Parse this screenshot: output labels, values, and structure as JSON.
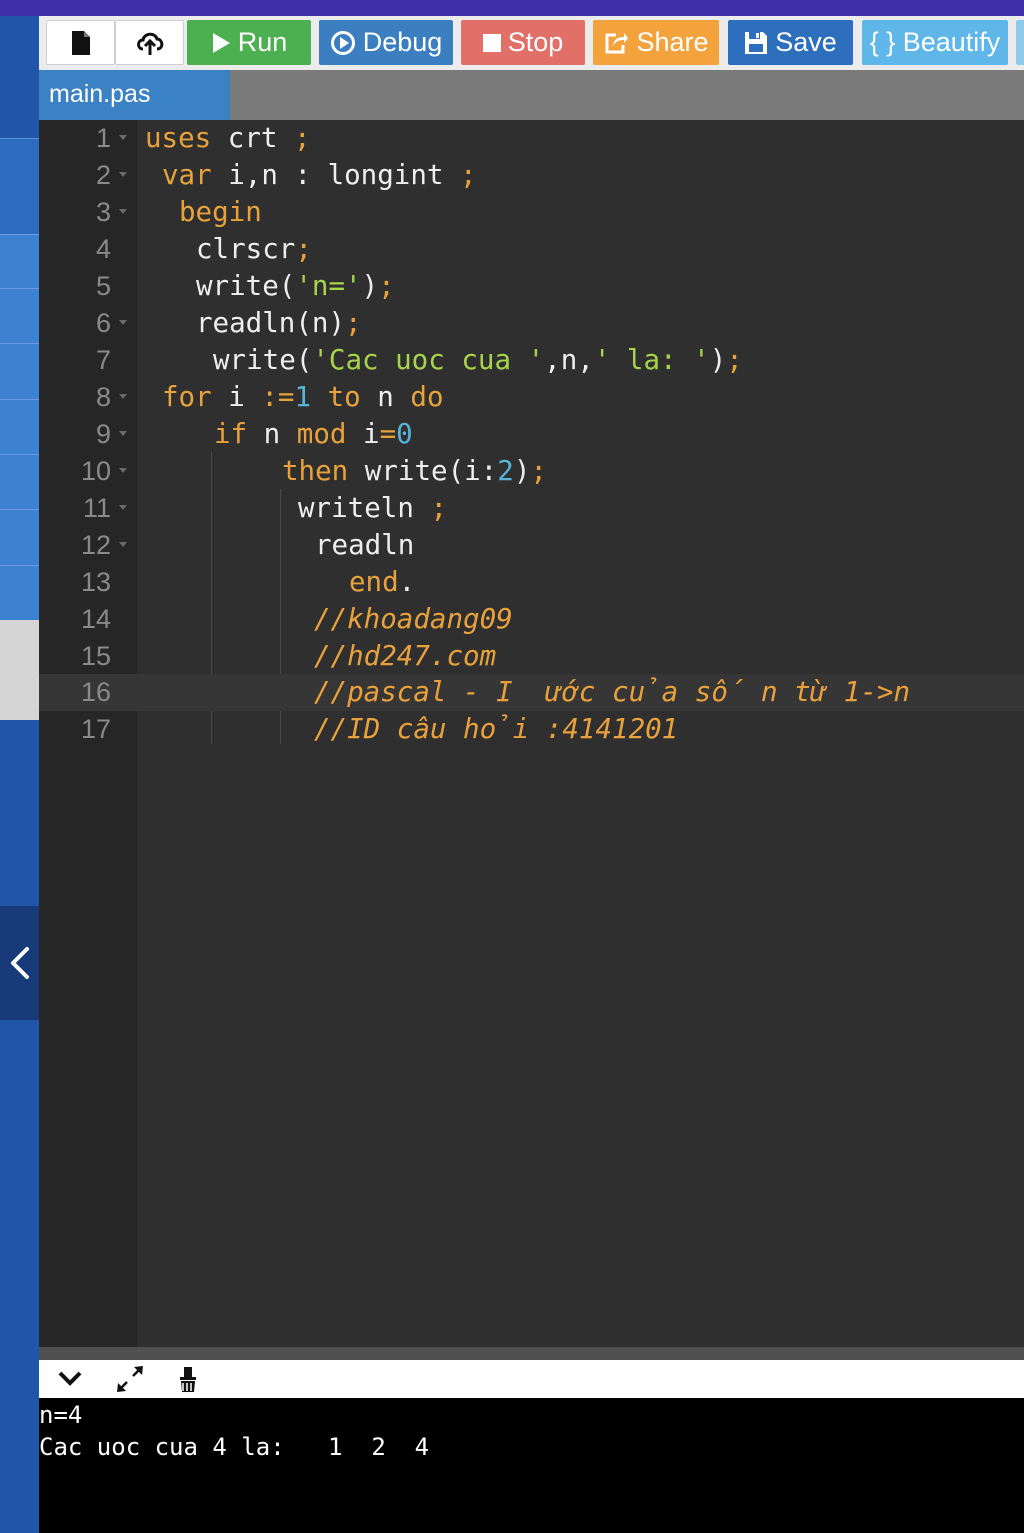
{
  "toolbar": {
    "buttons": [
      {
        "label": "",
        "icon": "new-file-icon",
        "bg": "#ffffff"
      },
      {
        "label": "",
        "icon": "upload-icon",
        "bg": "#ffffff"
      },
      {
        "label": "Run",
        "icon": "play-icon",
        "bg": "#4caf50"
      },
      {
        "label": "Debug",
        "icon": "debug-icon",
        "bg": "#3c7fc0"
      },
      {
        "label": "Stop",
        "icon": "stop-icon",
        "bg": "#e07068"
      },
      {
        "label": "Share",
        "icon": "share-icon",
        "bg": "#f4a23c"
      },
      {
        "label": "Save",
        "icon": "save-icon",
        "bg": "#2d6fbc"
      },
      {
        "label": "{ } Beautify",
        "icon": "",
        "bg": "#5fb6e8"
      }
    ]
  },
  "tab": {
    "label": "main.pas"
  },
  "editor": {
    "active_line": 16,
    "lines": [
      {
        "n": "1"
      },
      {
        "n": "2"
      },
      {
        "n": "3"
      },
      {
        "n": "4"
      },
      {
        "n": "5"
      },
      {
        "n": "6"
      },
      {
        "n": "7"
      },
      {
        "n": "8"
      },
      {
        "n": "9"
      },
      {
        "n": "10"
      },
      {
        "n": "11"
      },
      {
        "n": "12"
      },
      {
        "n": "13"
      },
      {
        "n": "14"
      },
      {
        "n": "15"
      },
      {
        "n": "16"
      },
      {
        "n": "17"
      }
    ],
    "code": {
      "l1": {
        "t0": "uses",
        "t1": " crt ",
        "t2": ";"
      },
      "l2": {
        "t0": "var",
        "t1": " i,n : longint ",
        "t2": ";"
      },
      "l3": {
        "t0": "begin"
      },
      "l4": {
        "t0": "clrscr",
        "t1": ";"
      },
      "l5": {
        "t0": "write(",
        "t1": "'n='",
        "t2": ")",
        "t3": ";"
      },
      "l6": {
        "t0": "readln(n)",
        "t1": ";"
      },
      "l7": {
        "t0": "write(",
        "t1": "'Cac uoc cua '",
        "t2": ",n,",
        "t3": "' la: '",
        "t4": ")",
        "t5": ";"
      },
      "l8": {
        "t0": "for",
        "t1": " i ",
        "t2": ":=",
        "t3": "1",
        "t4": " ",
        "t5": "to",
        "t6": " n ",
        "t7": "do"
      },
      "l9": {
        "t0": "if",
        "t1": " n ",
        "t2": "mod",
        "t3": " i",
        "t4": "=",
        "t5": "0"
      },
      "l10": {
        "t0": "then",
        "t1": " write(i:",
        "t2": "2",
        "t3": ")",
        "t4": ";"
      },
      "l11": {
        "t0": "writeln ",
        "t1": ";"
      },
      "l12": {
        "t0": "readln"
      },
      "l13": {
        "t0": "end",
        "t1": "."
      },
      "l14": {
        "t0": "//khoadang09"
      },
      "l15": {
        "t0": "//hd247.com"
      },
      "l16": {
        "t0": "//pascal - I  ước của số n từ 1->n"
      },
      "l17": {
        "t0": "//ID câu hỏi :4141201"
      }
    }
  },
  "console": {
    "lines": [
      "n=4",
      "Cac uoc cua 4 la:   1  2  4"
    ]
  }
}
